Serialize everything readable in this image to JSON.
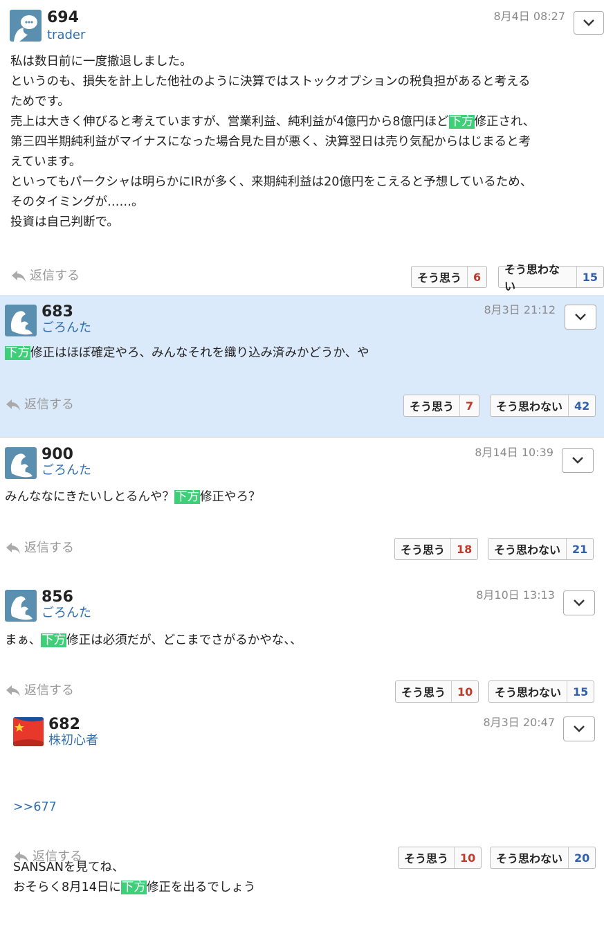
{
  "posts": [
    {
      "number": "694",
      "user": "trader",
      "date": "8月4日 08:27",
      "lines": [
        [
          "私は数日前に一度撤退しました。"
        ],
        [
          "というのも、損失を計上した他社のように決算ではストックオプションの税負担があると考える"
        ],
        [
          "ためです。"
        ],
        [
          "売上は大きく伸びると考えていますが、営業利益、純利益が4億円から8億円ほど",
          "下方",
          "修正され、"
        ],
        [
          "第三四半期純利益がマイナスになった場合見た目が悪く、決算翌日は売り気配からはじまると考"
        ],
        [
          "えています。"
        ],
        [
          "といってもパークシャは明らかにIRが多く、来期純利益は20億円をこえると予想しているため、"
        ],
        [
          "そのタイミングが……。"
        ],
        [
          "投資は自己判断で。"
        ]
      ],
      "reply": "返信する",
      "agree": "そう思う",
      "agree_count": "6",
      "disagree": "そう思わない",
      "disagree_count": "15"
    },
    {
      "number": "683",
      "user": "ごろんた",
      "date": "8月3日 21:12",
      "lines": [
        [
          "",
          "下方",
          "修正はほぼ確定やろ、みんなそれを織り込み済みかどうか、や"
        ]
      ],
      "reply": "返信する",
      "agree": "そう思う",
      "agree_count": "7",
      "disagree": "そう思わない",
      "disagree_count": "42"
    },
    {
      "number": "900",
      "user": "ごろんた",
      "date": "8月14日 10:39",
      "lines": [
        [
          "みんななにきたいしとるんや？",
          "下方",
          "修正やろ？"
        ]
      ],
      "reply": "返信する",
      "agree": "そう思う",
      "agree_count": "18",
      "disagree": "そう思わない",
      "disagree_count": "21"
    },
    {
      "number": "856",
      "user": "ごろんた",
      "date": "8月10日 13:13",
      "lines": [
        [
          "まぁ、",
          "下方",
          "修正は必須だが、どこまでさがるかやな、、"
        ]
      ],
      "reply": "返信する",
      "agree": "そう思う",
      "agree_count": "10",
      "disagree": "そう思わない",
      "disagree_count": "15"
    },
    {
      "number": "682",
      "user": "株初心者",
      "date": "8月3日 20:47",
      "anchor": ">>677",
      "lines": [
        [
          "SANSANを見てね、"
        ],
        [
          "おそらく8月14日に",
          "下方",
          "修正を出るでしょう"
        ]
      ],
      "reply": "返信する",
      "agree": "そう思う",
      "agree_count": "10",
      "disagree": "そう思わない",
      "disagree_count": "20"
    }
  ],
  "colors": {
    "highlight": "#3fcf79",
    "selected_bg": "#dbeafb",
    "link": "#2f6fad"
  },
  "icons": {
    "avatar": "speech-bubble-avatar-icon",
    "menu": "chevron-down-icon",
    "reply": "reply-arrow-icon"
  }
}
